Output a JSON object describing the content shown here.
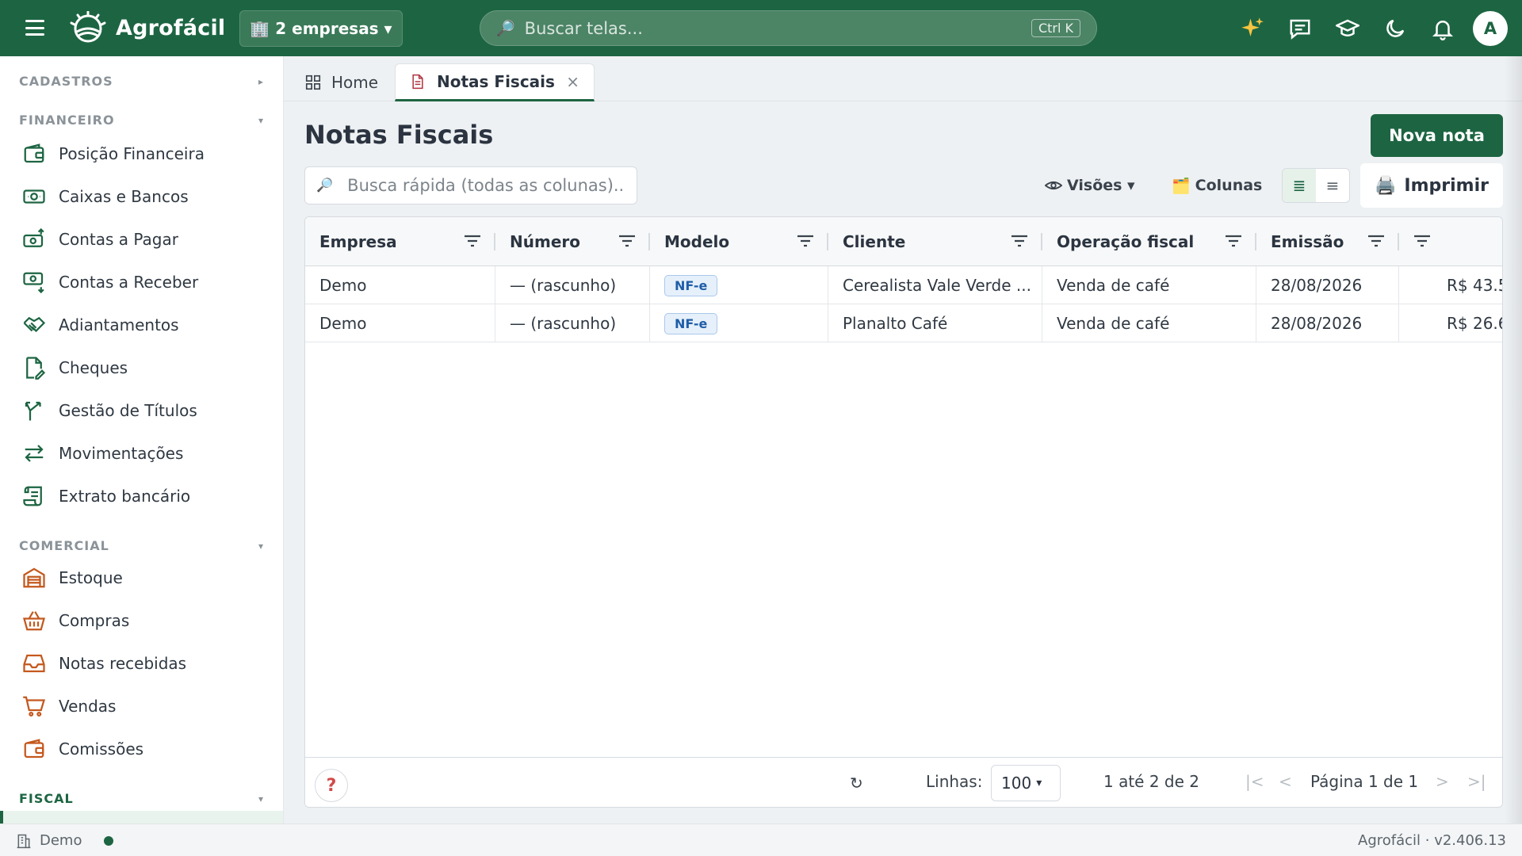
{
  "topbar": {
    "brand": "Agrofácil",
    "company_selector": "🏢 2 empresas ▾",
    "search_placeholder": "Buscar telas...",
    "search_shortcut": "Ctrl K",
    "avatar_initial": "A",
    "icons": [
      "sparkles-icon",
      "chat-icon",
      "graduation-cap-icon",
      "moon-icon",
      "bell-icon"
    ]
  },
  "sidebar": {
    "sections": {
      "cadastros": "CADASTROS",
      "financeiro": "FINANCEIRO",
      "comercial": "COMERCIAL",
      "fiscal": "FISCAL"
    },
    "financeiro_items": [
      {
        "label": "Posição Financeira",
        "icon": "wallet-icon"
      },
      {
        "label": "Caixas e Bancos",
        "icon": "banknote-icon"
      },
      {
        "label": "Contas a Pagar",
        "icon": "cash-out-icon"
      },
      {
        "label": "Contas a Receber",
        "icon": "cash-in-icon"
      },
      {
        "label": "Adiantamentos",
        "icon": "handshake-icon"
      },
      {
        "label": "Cheques",
        "icon": "check-signature-icon"
      },
      {
        "label": "Gestão de Títulos",
        "icon": "split-arrow-icon"
      },
      {
        "label": "Movimentações",
        "icon": "transfer-icon"
      },
      {
        "label": "Extrato bancário",
        "icon": "scroll-icon"
      }
    ],
    "comercial_items": [
      {
        "label": "Estoque",
        "icon": "warehouse-icon"
      },
      {
        "label": "Compras",
        "icon": "basket-icon"
      },
      {
        "label": "Notas recebidas",
        "icon": "inbox-icon"
      },
      {
        "label": "Vendas",
        "icon": "cart-icon"
      },
      {
        "label": "Comissões",
        "icon": "wallet-icon"
      }
    ]
  },
  "tabs": {
    "home": "Home",
    "notas": "Notas Fiscais",
    "close": "×"
  },
  "main": {
    "title": "Notas Fiscais",
    "new_button": "Nova nota",
    "quick_search_placeholder": "Busca rápida (todas as colunas)..",
    "views_label": "Visões ▾",
    "columns_label": "Colunas",
    "print_label": "Imprimir"
  },
  "grid": {
    "columns": [
      "Empresa",
      "Número",
      "Modelo",
      "Cliente",
      "Operação fiscal",
      "Emissão",
      ""
    ],
    "rows": [
      {
        "empresa": "Demo",
        "numero": "— (rascunho)",
        "modelo": "NF-e",
        "cliente": "Cerealista Vale Verde ...",
        "operacao": "Venda de café",
        "emissao": "28/08/2026",
        "valor": "R$ 43.5"
      },
      {
        "empresa": "Demo",
        "numero": "— (rascunho)",
        "modelo": "NF-e",
        "cliente": "Planalto Café",
        "operacao": "Venda de café",
        "emissao": "28/08/2026",
        "valor": "R$ 26.6"
      }
    ],
    "footer": {
      "help": "?",
      "refresh": "↻",
      "rows_label": "Linhas:",
      "rows_value": "100",
      "range": "1 até 2 de 2",
      "page": "Página 1 de 1"
    }
  },
  "statusbar": {
    "company": "Demo",
    "version": "Agrofácil · v2.406.13"
  },
  "colors": {
    "brand_green": "#1d6542",
    "badge_blue": "#1f5ea8",
    "icon_orange": "#c4581d",
    "icon_green": "#1d6542"
  }
}
